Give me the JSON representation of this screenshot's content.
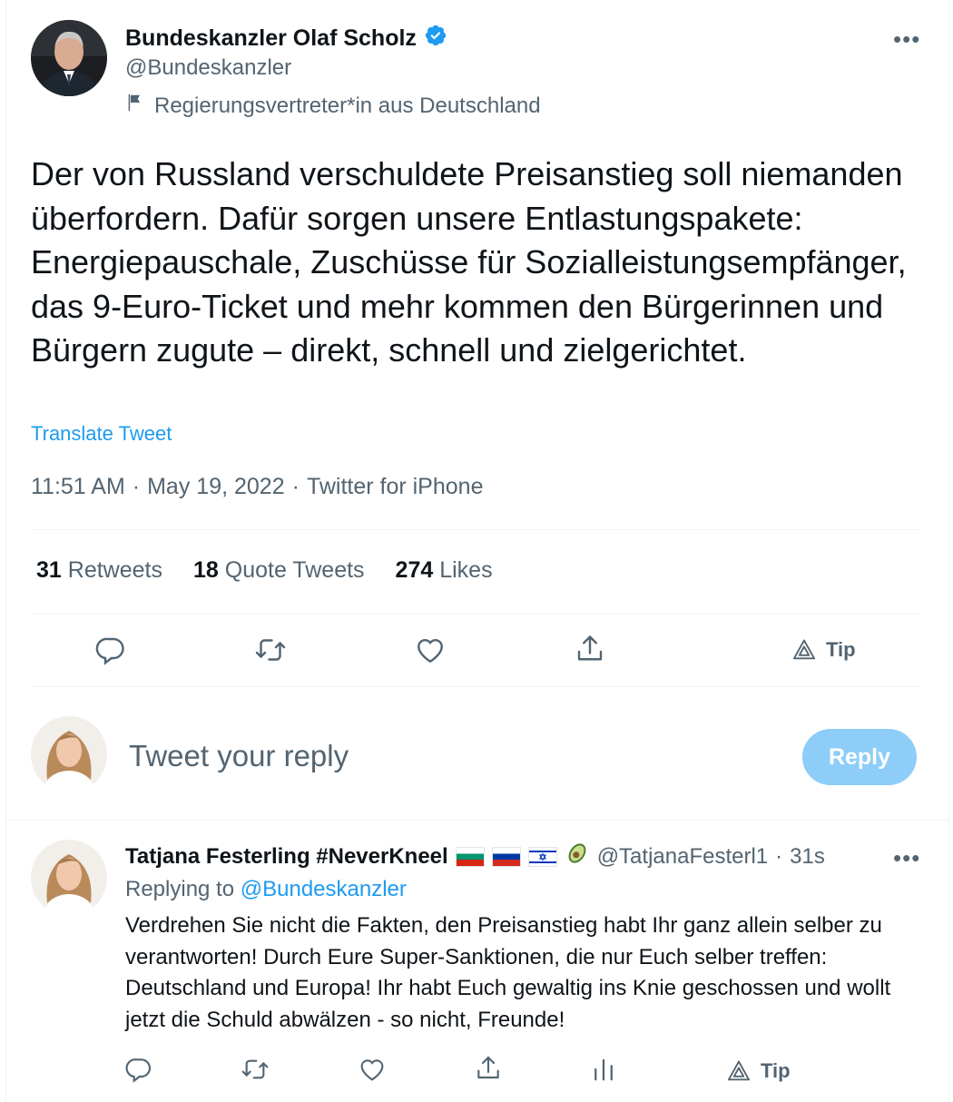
{
  "tweet": {
    "author_name": "Bundeskanzler Olaf Scholz",
    "author_handle": "@Bundeskanzler",
    "gov_label": "Regierungsvertreter*in aus Deutschland",
    "text": "Der von Russland verschuldete Preisanstieg soll niemanden überfordern. Dafür sorgen unsere Entlastungspakete: Energiepauschale, Zuschüsse für Sozialleistungsempfänger, das 9-Euro-Ticket und mehr kommen den Bürgerinnen und Bürgern zugute – direkt, schnell und zielgerichtet.",
    "translate_label": "Translate Tweet",
    "time": "11:51 AM",
    "date": "May 19, 2022",
    "source": "Twitter for iPhone",
    "separator": "·",
    "stats": {
      "retweets_count": "31",
      "retweets_label": "Retweets",
      "quotes_count": "18",
      "quotes_label": "Quote Tweets",
      "likes_count": "274",
      "likes_label": "Likes"
    },
    "tip_label": "Tip",
    "more_label": "•••"
  },
  "compose": {
    "placeholder": "Tweet your reply",
    "reply_button": "Reply"
  },
  "reply": {
    "author_name": "Tatjana Festerling #NeverKneel",
    "author_handle": "@TatjanaFesterl1",
    "time": "31s",
    "separator": "·",
    "replying_prefix": "Replying to",
    "replying_to": "@Bundeskanzler",
    "text": "Verdrehen Sie nicht die Fakten, den Preisanstieg habt Ihr ganz allein selber zu verantworten! Durch Eure Super-Sanktionen, die nur Euch selber treffen: Deutschland und Europa! Ihr habt Euch gewaltig ins Knie geschossen und wollt jetzt die Schuld abwälzen - so nicht, Freunde!",
    "tip_label": "Tip",
    "more_label": "•••"
  },
  "colors": {
    "accent": "#1d9bf0",
    "reply_button_disabled": "#8ecdf8",
    "secondary_text": "#536471",
    "primary_text": "#0f1419",
    "divider": "#eff3f4"
  },
  "icons": [
    "verified-badge-icon",
    "flag-icon",
    "more-icon",
    "reply-icon",
    "retweet-icon",
    "like-icon",
    "share-icon",
    "tip-icon",
    "analytics-icon",
    "avocado-emoji"
  ]
}
